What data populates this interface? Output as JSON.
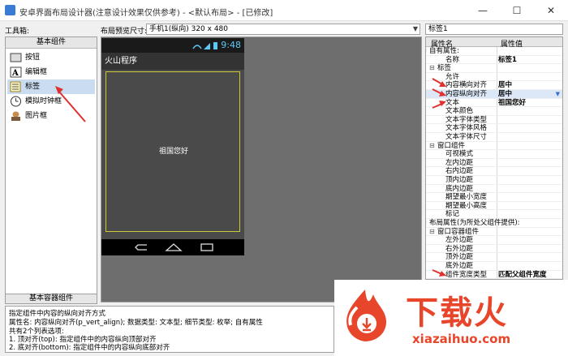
{
  "window": {
    "title": "安卓界面布局设计器(注意设计效果仅供参考) - <默认布局> - [已修改]",
    "min": "—",
    "max": "☐",
    "close": "✕"
  },
  "toolbar": {
    "tools_label": "工具箱:",
    "preview_size_label": "布局预览尺寸:",
    "preview_size_value": "手机1(纵向) 320 x 480",
    "component_name": "标签1"
  },
  "palette": {
    "header": "基本组件",
    "items": [
      {
        "label": "按钮",
        "icon": "button-icon"
      },
      {
        "label": "编辑框",
        "icon": "edit-box-icon"
      },
      {
        "label": "标签",
        "icon": "label-icon"
      },
      {
        "label": "模拟时钟框",
        "icon": "clock-icon"
      },
      {
        "label": "图片框",
        "icon": "image-icon"
      }
    ],
    "footer": "基本容器组件"
  },
  "phone": {
    "time": "9:48",
    "app_title": "火山程序",
    "label_text": "祖国您好"
  },
  "props": {
    "col_name": "属性名",
    "col_value": "属性值",
    "rows": [
      {
        "name": "自有属性:",
        "value": "",
        "kind": "grp",
        "toggle": "⊟"
      },
      {
        "name": "名称",
        "value": "标签1",
        "kind": "row"
      },
      {
        "name": "标签",
        "value": "",
        "kind": "sec",
        "toggle": "⊟"
      },
      {
        "name": "允许",
        "value": "",
        "kind": "row"
      },
      {
        "name": "内容横向对齐",
        "value": "居中",
        "kind": "row"
      },
      {
        "name": "内容纵向对齐",
        "value": "居中",
        "kind": "row",
        "selected": true
      },
      {
        "name": "文本",
        "value": "祖国您好",
        "kind": "row"
      },
      {
        "name": "文本颜色",
        "value": "",
        "kind": "row"
      },
      {
        "name": "文本字体类型",
        "value": "",
        "kind": "row"
      },
      {
        "name": "文本字体风格",
        "value": "",
        "kind": "row"
      },
      {
        "name": "文本字体尺寸",
        "value": "",
        "kind": "row"
      },
      {
        "name": "窗口组件",
        "value": "",
        "kind": "sec",
        "toggle": "⊟"
      },
      {
        "name": "可视模式",
        "value": "",
        "kind": "row"
      },
      {
        "name": "左内边距",
        "value": "",
        "kind": "row"
      },
      {
        "name": "右内边距",
        "value": "",
        "kind": "row"
      },
      {
        "name": "顶内边距",
        "value": "",
        "kind": "row"
      },
      {
        "name": "底内边距",
        "value": "",
        "kind": "row"
      },
      {
        "name": "期望最小宽度",
        "value": "",
        "kind": "row"
      },
      {
        "name": "期望最小高度",
        "value": "",
        "kind": "row"
      },
      {
        "name": "标记",
        "value": "",
        "kind": "row"
      },
      {
        "name": "布局属性(为所处父组件提供):",
        "value": "",
        "kind": "grp",
        "toggle": "⊟"
      },
      {
        "name": "窗口容器组件",
        "value": "",
        "kind": "sec",
        "toggle": "⊟"
      },
      {
        "name": "左外边距",
        "value": "",
        "kind": "row"
      },
      {
        "name": "右外边距",
        "value": "",
        "kind": "row"
      },
      {
        "name": "顶外边距",
        "value": "",
        "kind": "row"
      },
      {
        "name": "底外边距",
        "value": "",
        "kind": "row"
      },
      {
        "name": "组件宽度类型",
        "value": "匹配父组件宽度",
        "kind": "row"
      }
    ]
  },
  "description": {
    "lines": [
      "指定组件中内容的纵向对齐方式",
      "属性名: 内容纵向对齐(p_vert_align); 数据类型: 文本型; 细节类型: 枚举; 自有属性",
      "共有2个列表选项:",
      "  1. 顶对齐(top): 指定组件中的内容纵向顶部对齐",
      "  2. 底对齐(bottom): 指定组件中的内容纵向底部对齐"
    ]
  },
  "watermark": {
    "brand": "下载火",
    "url": "xiazaihuo.com"
  },
  "colors": {
    "accent_red": "#e8462b",
    "selection_blue": "#c9dcf0",
    "phone_time": "#5ec8f4"
  }
}
